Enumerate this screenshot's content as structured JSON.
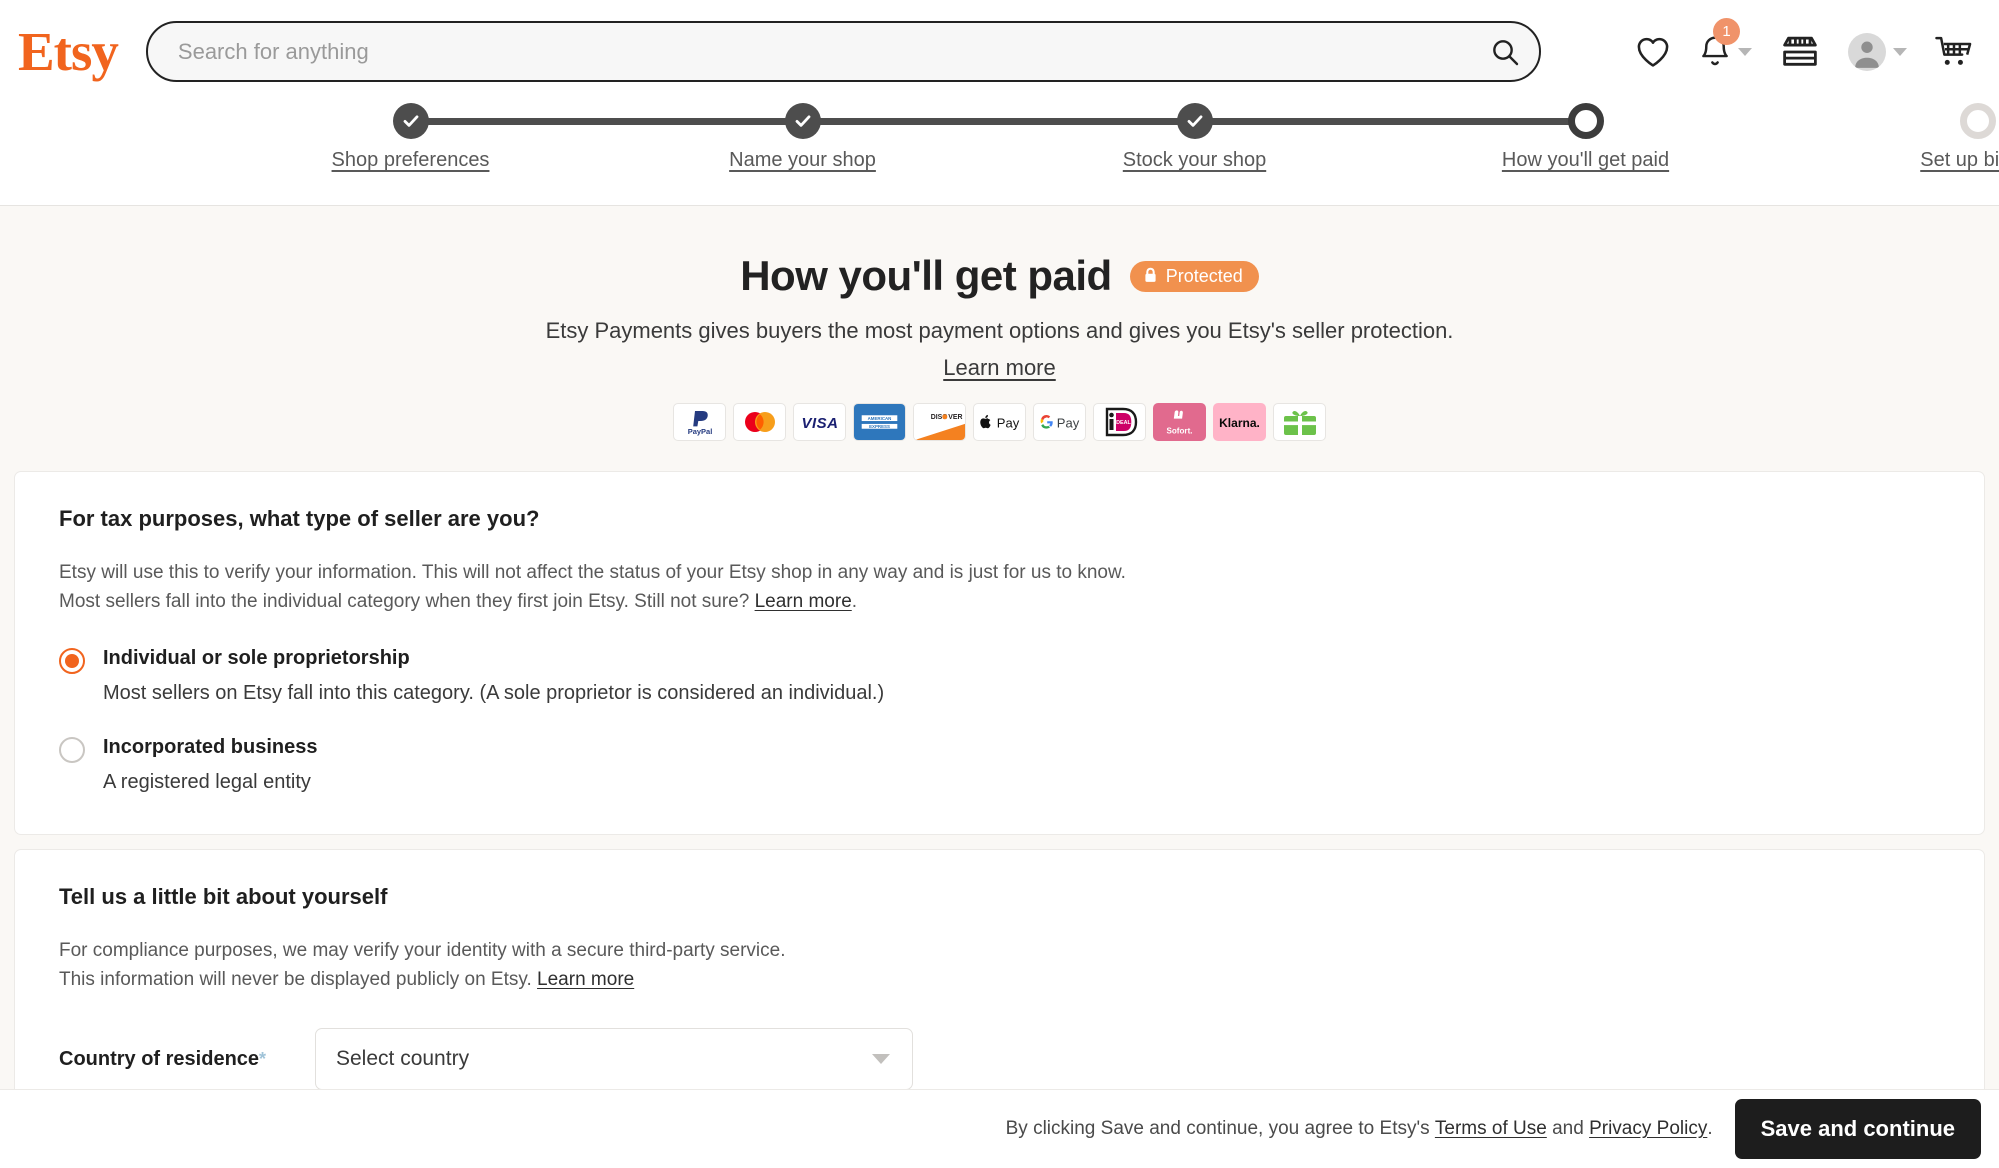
{
  "header": {
    "logo_text": "Etsy",
    "logo_color": "#f1641e",
    "search": {
      "placeholder": "Search for anything",
      "value": ""
    },
    "icons": {
      "favorites": "heart-icon",
      "notifications": "bell-icon",
      "notifications_badge": "1",
      "shop": "storefront-icon",
      "account": "avatar-icon",
      "cart": "cart-icon"
    }
  },
  "stepper": {
    "steps": [
      {
        "label": "Shop preferences",
        "state": "done"
      },
      {
        "label": "Name your shop",
        "state": "done"
      },
      {
        "label": "Stock your shop",
        "state": "done"
      },
      {
        "label": "How you'll get paid",
        "state": "current"
      },
      {
        "label": "Set up billing",
        "state": "todo"
      }
    ]
  },
  "hero": {
    "title": "How you'll get paid",
    "badge_label": "Protected",
    "badge_color": "#f1914e",
    "subtitle": "Etsy Payments gives buyers the most payment options and gives you Etsy's seller protection.",
    "learn_more": "Learn more",
    "payment_methods": [
      "PayPal",
      "Mastercard",
      "VISA",
      "American Express",
      "Discover",
      "Apple Pay",
      "G Pay",
      "iDEAL",
      "Sofort",
      "Klarna",
      "Gift Card"
    ]
  },
  "seller_type_card": {
    "heading": "For tax purposes, what type of seller are you?",
    "description_line1": "Etsy will use this to verify your information. This will not affect the status of your Etsy shop in any way and is just for us to know.",
    "description_line2_pre": "Most sellers fall into the individual category when they first join Etsy. Still not sure?",
    "description_link": "Learn more",
    "description_line2_post": ".",
    "options": [
      {
        "title": "Individual or sole proprietorship",
        "desc": "Most sellers on Etsy fall into this category. (A sole proprietor is considered an individual.)",
        "selected": true
      },
      {
        "title": "Incorporated business",
        "desc": "A registered legal entity",
        "selected": false
      }
    ]
  },
  "about_card": {
    "heading": "Tell us a little bit about yourself",
    "description_line1": "For compliance purposes, we may verify your identity with a secure third-party service.",
    "description_line2_pre": "This information will never be displayed publicly on Etsy.",
    "description_link": "Learn more",
    "country_label": "Country of residence",
    "country_required_marker": "*",
    "country_value": "Select country"
  },
  "bottom_bar": {
    "text_pre": "By clicking Save and continue, you agree to Etsy's",
    "terms_link": "Terms of Use",
    "text_and": "and",
    "privacy_link": "Privacy Policy",
    "text_post": ".",
    "save_label": "Save and continue"
  }
}
